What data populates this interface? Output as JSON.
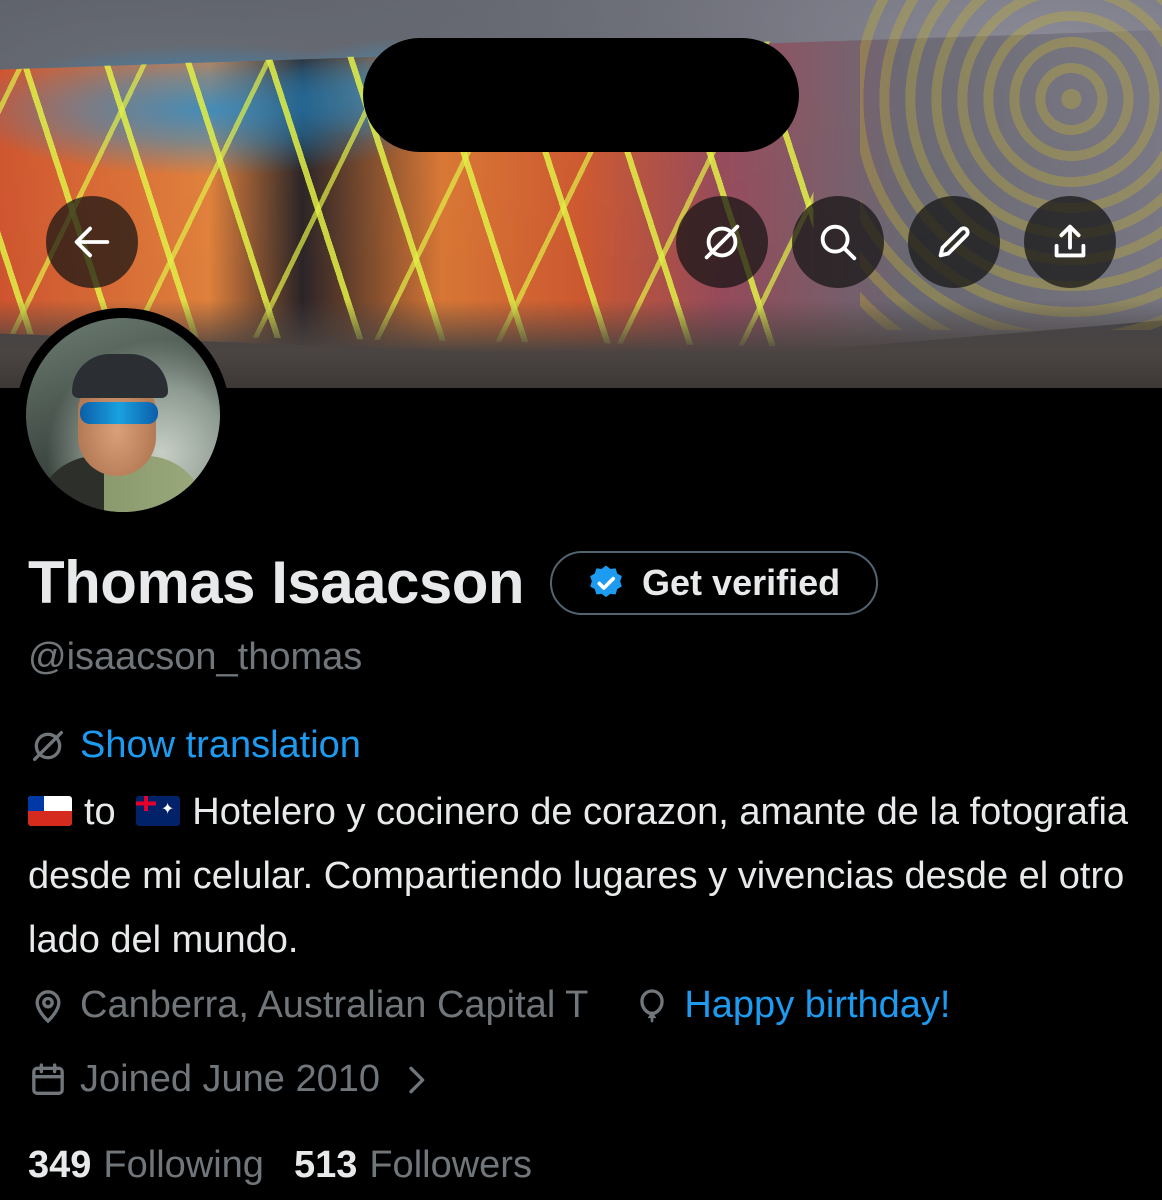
{
  "header": {
    "back_icon": "arrow-left-icon",
    "actions": [
      "translate-icon",
      "search-icon",
      "edit-icon",
      "share-icon"
    ]
  },
  "profile": {
    "name": "Thomas Isaacson",
    "verify_label": "Get verified",
    "handle": "@isaacson_thomas",
    "show_translation": "Show translation",
    "bio_to": "to",
    "bio_text": "Hotelero y cocinero de corazon, amante de la fotografia desde mi celular. Compartiendo lugares y vivencias desde el otro lado del mundo.",
    "location": "Canberra, Australian Capital T",
    "birthday": "Happy birthday!",
    "joined": "Joined June 2010"
  },
  "stats": {
    "following_count": "349",
    "following_label": "Following",
    "followers_count": "513",
    "followers_label": "Followers"
  },
  "colors": {
    "accent": "#1d9bf0",
    "muted": "#71767b",
    "text": "#e7e9ea",
    "background": "#000000"
  }
}
